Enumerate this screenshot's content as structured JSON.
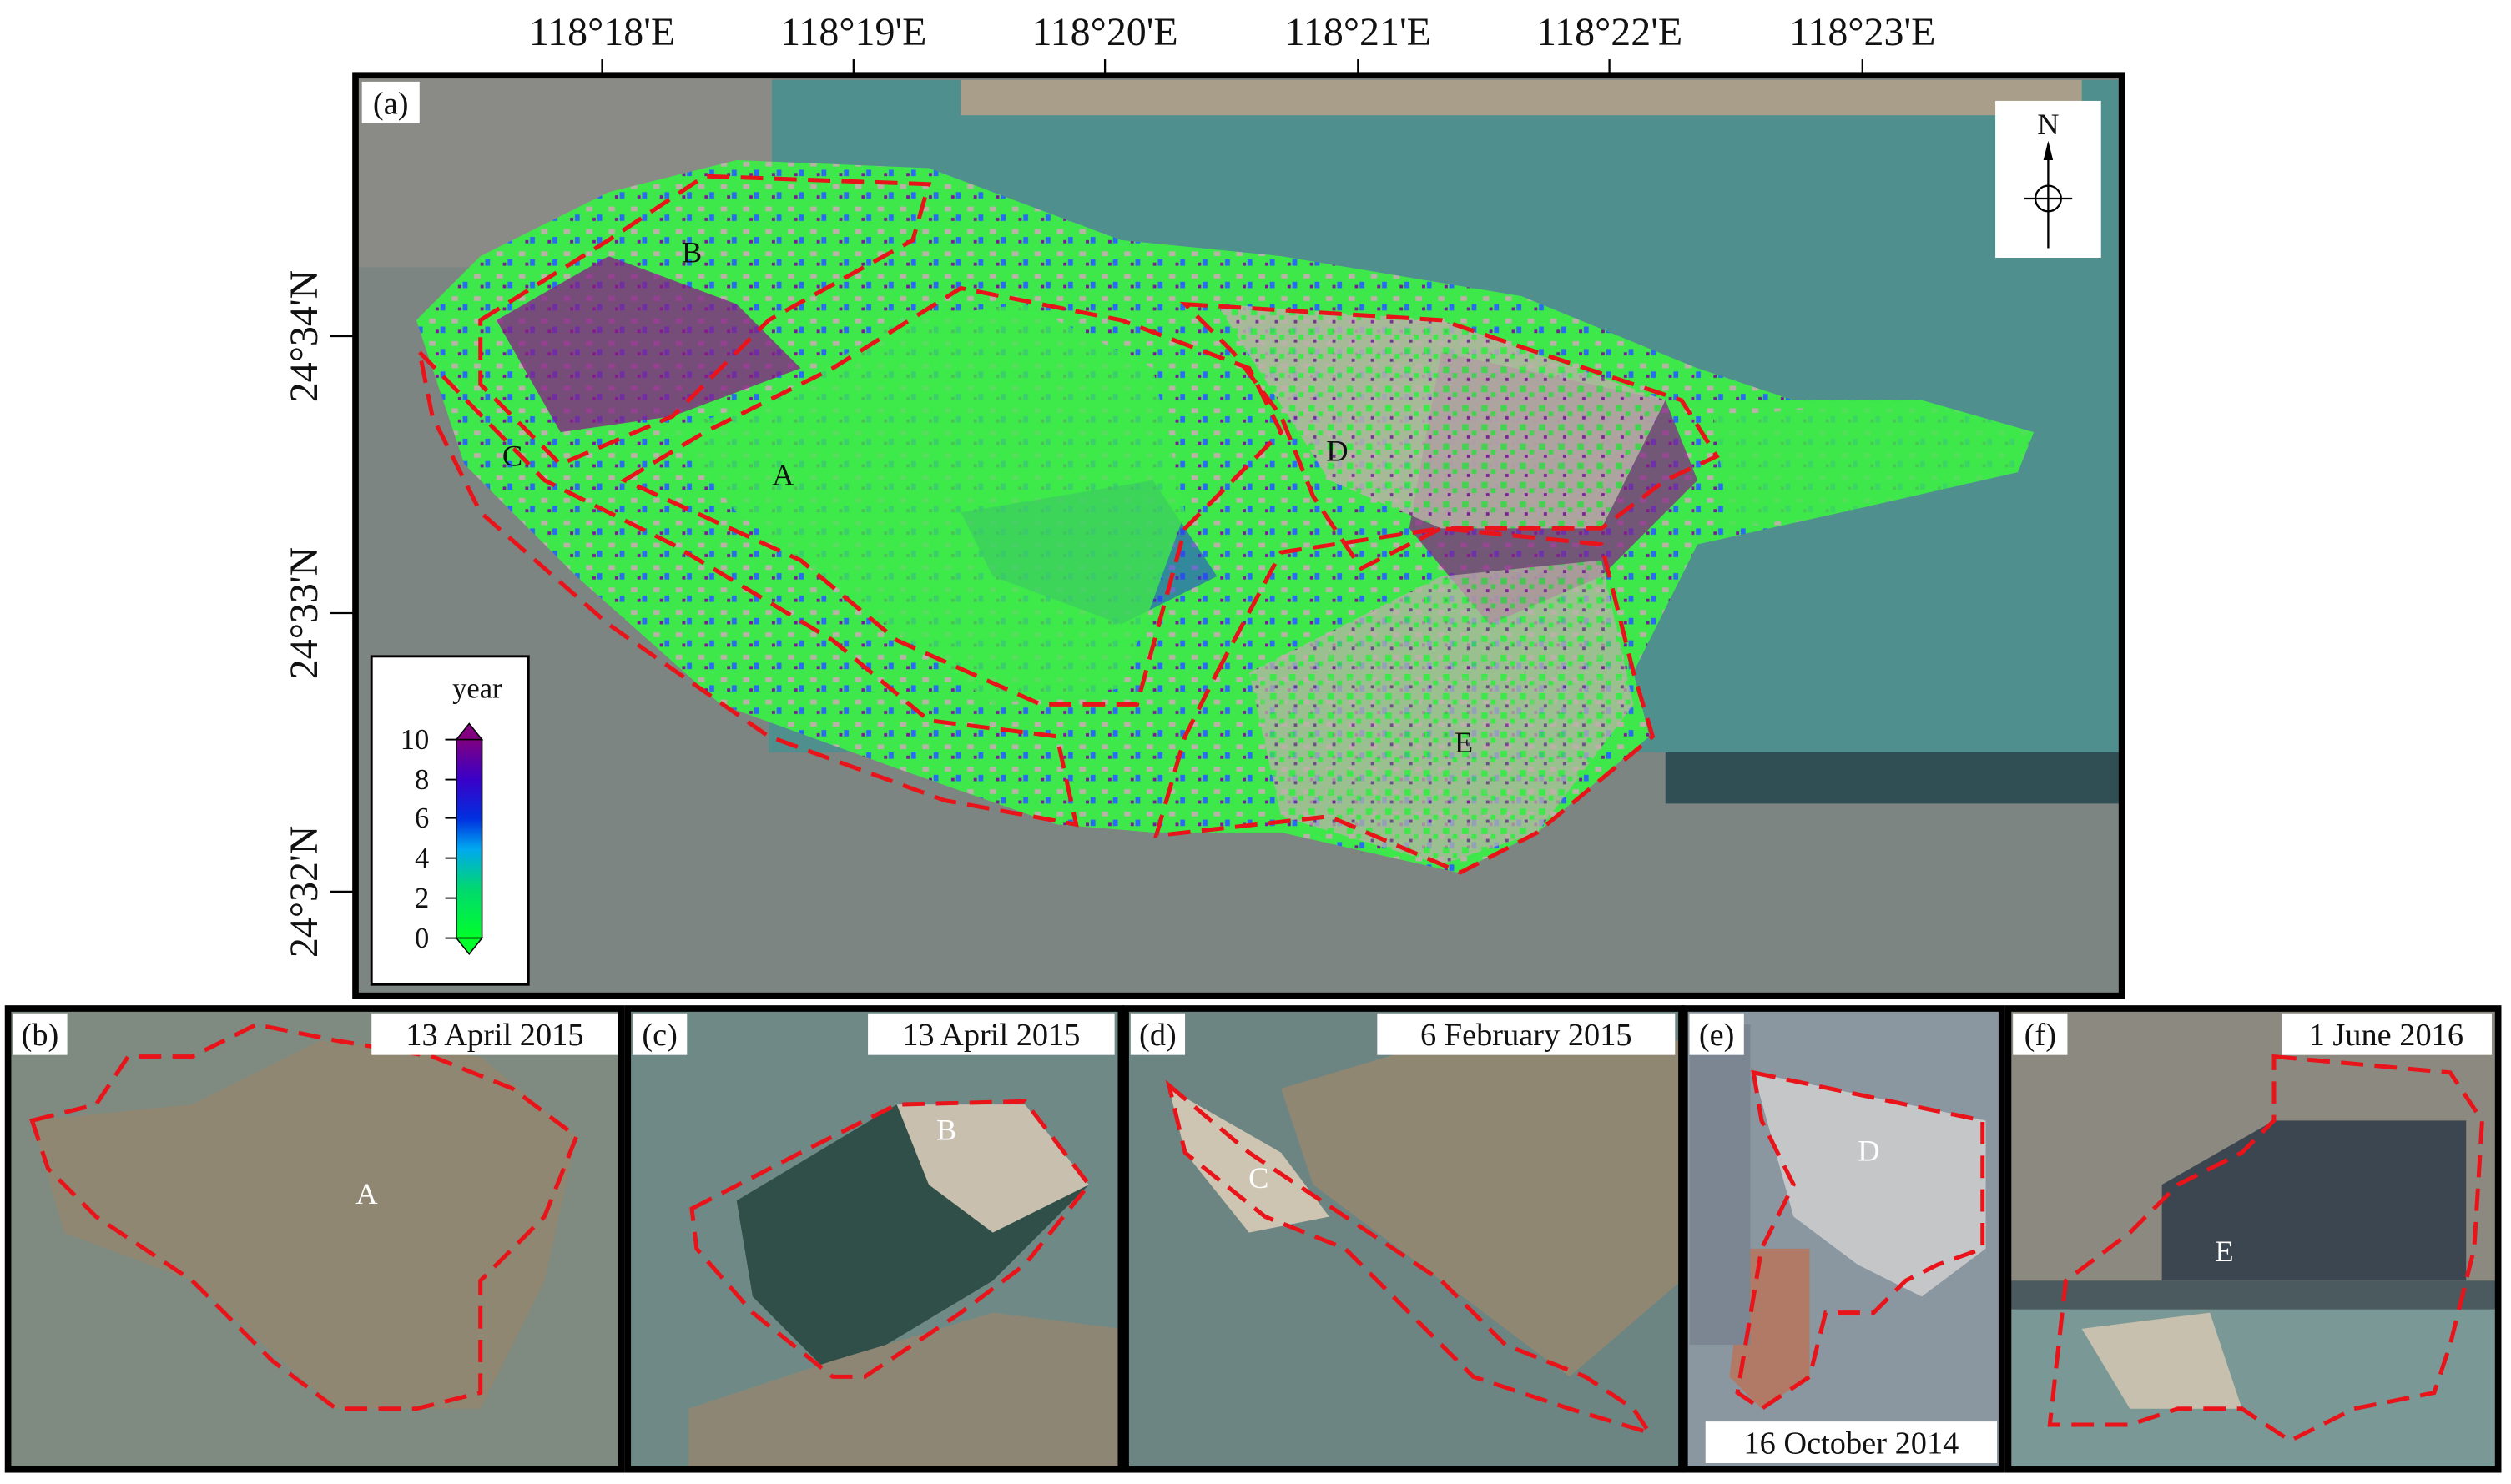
{
  "figure": {
    "main_panel": {
      "label": "(a)",
      "lon_ticks": [
        "118°18'E",
        "118°19'E",
        "118°20'E",
        "118°21'E",
        "118°22'E",
        "118°23'E"
      ],
      "lat_ticks": [
        "24°34'N",
        "24°33'N",
        "24°32'N"
      ],
      "regions": [
        "A",
        "B",
        "C",
        "D",
        "E"
      ],
      "north_arrow": "N",
      "legend": {
        "title": "year",
        "ticks": [
          "10",
          "8",
          "6",
          "4",
          "2",
          "0"
        ],
        "range": [
          0,
          10
        ],
        "colors": [
          "#00ff2a",
          "#00d870",
          "#00a8f0",
          "#0030e0",
          "#3a00c8",
          "#800080"
        ]
      }
    },
    "sub_panels": [
      {
        "label": "(b)",
        "date": "13 April 2015",
        "region": "A"
      },
      {
        "label": "(c)",
        "date": "13 April 2015",
        "region": "B"
      },
      {
        "label": "(d)",
        "date": "6 February 2015",
        "region": "C"
      },
      {
        "label": "(e)",
        "date": "16 October 2014",
        "region": "D"
      },
      {
        "label": "(f)",
        "date": "1 June 2016",
        "region": "E"
      }
    ],
    "colors": {
      "boundary": "#e8141a",
      "water": "#7d8f8c",
      "sea": "#4f8f8e",
      "land": "#b9b2a6"
    }
  }
}
